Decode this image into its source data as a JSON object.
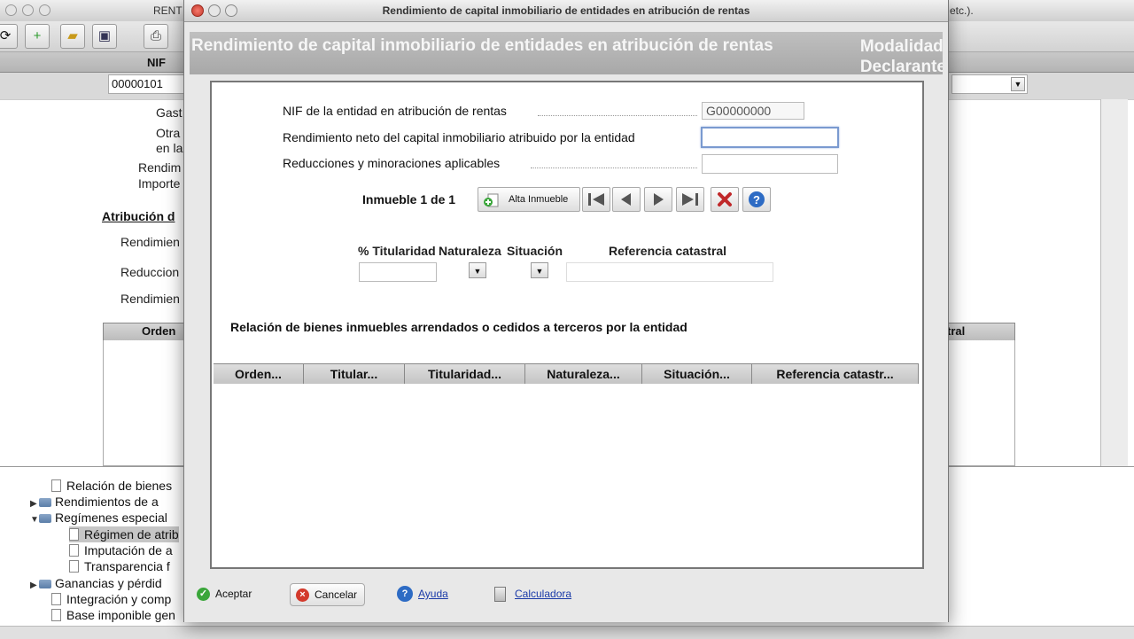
{
  "background": {
    "window_title": "RENT",
    "window_title_right": "etc.).",
    "nif_header": "NIF",
    "nif_value": "00000101",
    "form_labels": [
      "Gast",
      "Otra",
      "en la",
      "Rendim",
      "Importe"
    ],
    "section_title": "Atribución d",
    "section_labels": [
      "Rendimien",
      "Reduccion",
      "Rendimien"
    ],
    "table_header_left": "Orden",
    "table_header_right": "tral",
    "tree": [
      {
        "label": "Relación de bienes",
        "type": "doc",
        "expanded": null
      },
      {
        "label": "Rendimientos de a",
        "type": "folder",
        "expanded": false
      },
      {
        "label": "Regímenes especial",
        "type": "folder",
        "expanded": true
      },
      {
        "label": "Régimen de atrib",
        "type": "doc",
        "expanded": null,
        "selected": true
      },
      {
        "label": "Imputación de a",
        "type": "doc",
        "expanded": null
      },
      {
        "label": "Transparencia f",
        "type": "doc",
        "expanded": null
      },
      {
        "label": "Ganancias y pérdid",
        "type": "folder",
        "expanded": false
      },
      {
        "label": "Integración y comp",
        "type": "doc",
        "expanded": null
      },
      {
        "label": "Base imponible gen",
        "type": "doc",
        "expanded": null
      }
    ]
  },
  "dialog": {
    "window_title": "Rendimiento de capital inmobiliario de entidades en atribución de rentas",
    "header_title": "Rendimiento de capital inmobiliario de entidades en atribución de rentas",
    "header_right_1": "Modalidad",
    "header_right_2": "Declarante",
    "fields": {
      "nif_label": "NIF de la entidad en atribución de rentas",
      "nif_value": "G00000000",
      "rendimiento_label": "Rendimiento neto del capital inmobiliario atribuido por la entidad",
      "rendimiento_value": "",
      "reducciones_label": "Reducciones y minoraciones aplicables",
      "reducciones_value": ""
    },
    "inmueble_label": "Inmueble 1 de 1",
    "alta_button": "Alta Inmueble",
    "columns": {
      "titularidad": "% Titularidad",
      "naturaleza": "Naturaleza",
      "situacion": "Situación",
      "referencia": "Referencia catastral"
    },
    "relacion_title": "Relación de bienes inmuebles arrendados o cedidos a terceros por la entidad",
    "grid_headers": [
      "Orden...",
      "Titular...",
      "Titularidad...",
      "Naturaleza...",
      "Situación...",
      "Referencia catastr..."
    ],
    "footer": {
      "aceptar": "Aceptar",
      "cancelar": "Cancelar",
      "ayuda": "Ayuda",
      "calculadora": "Calculadora"
    }
  }
}
